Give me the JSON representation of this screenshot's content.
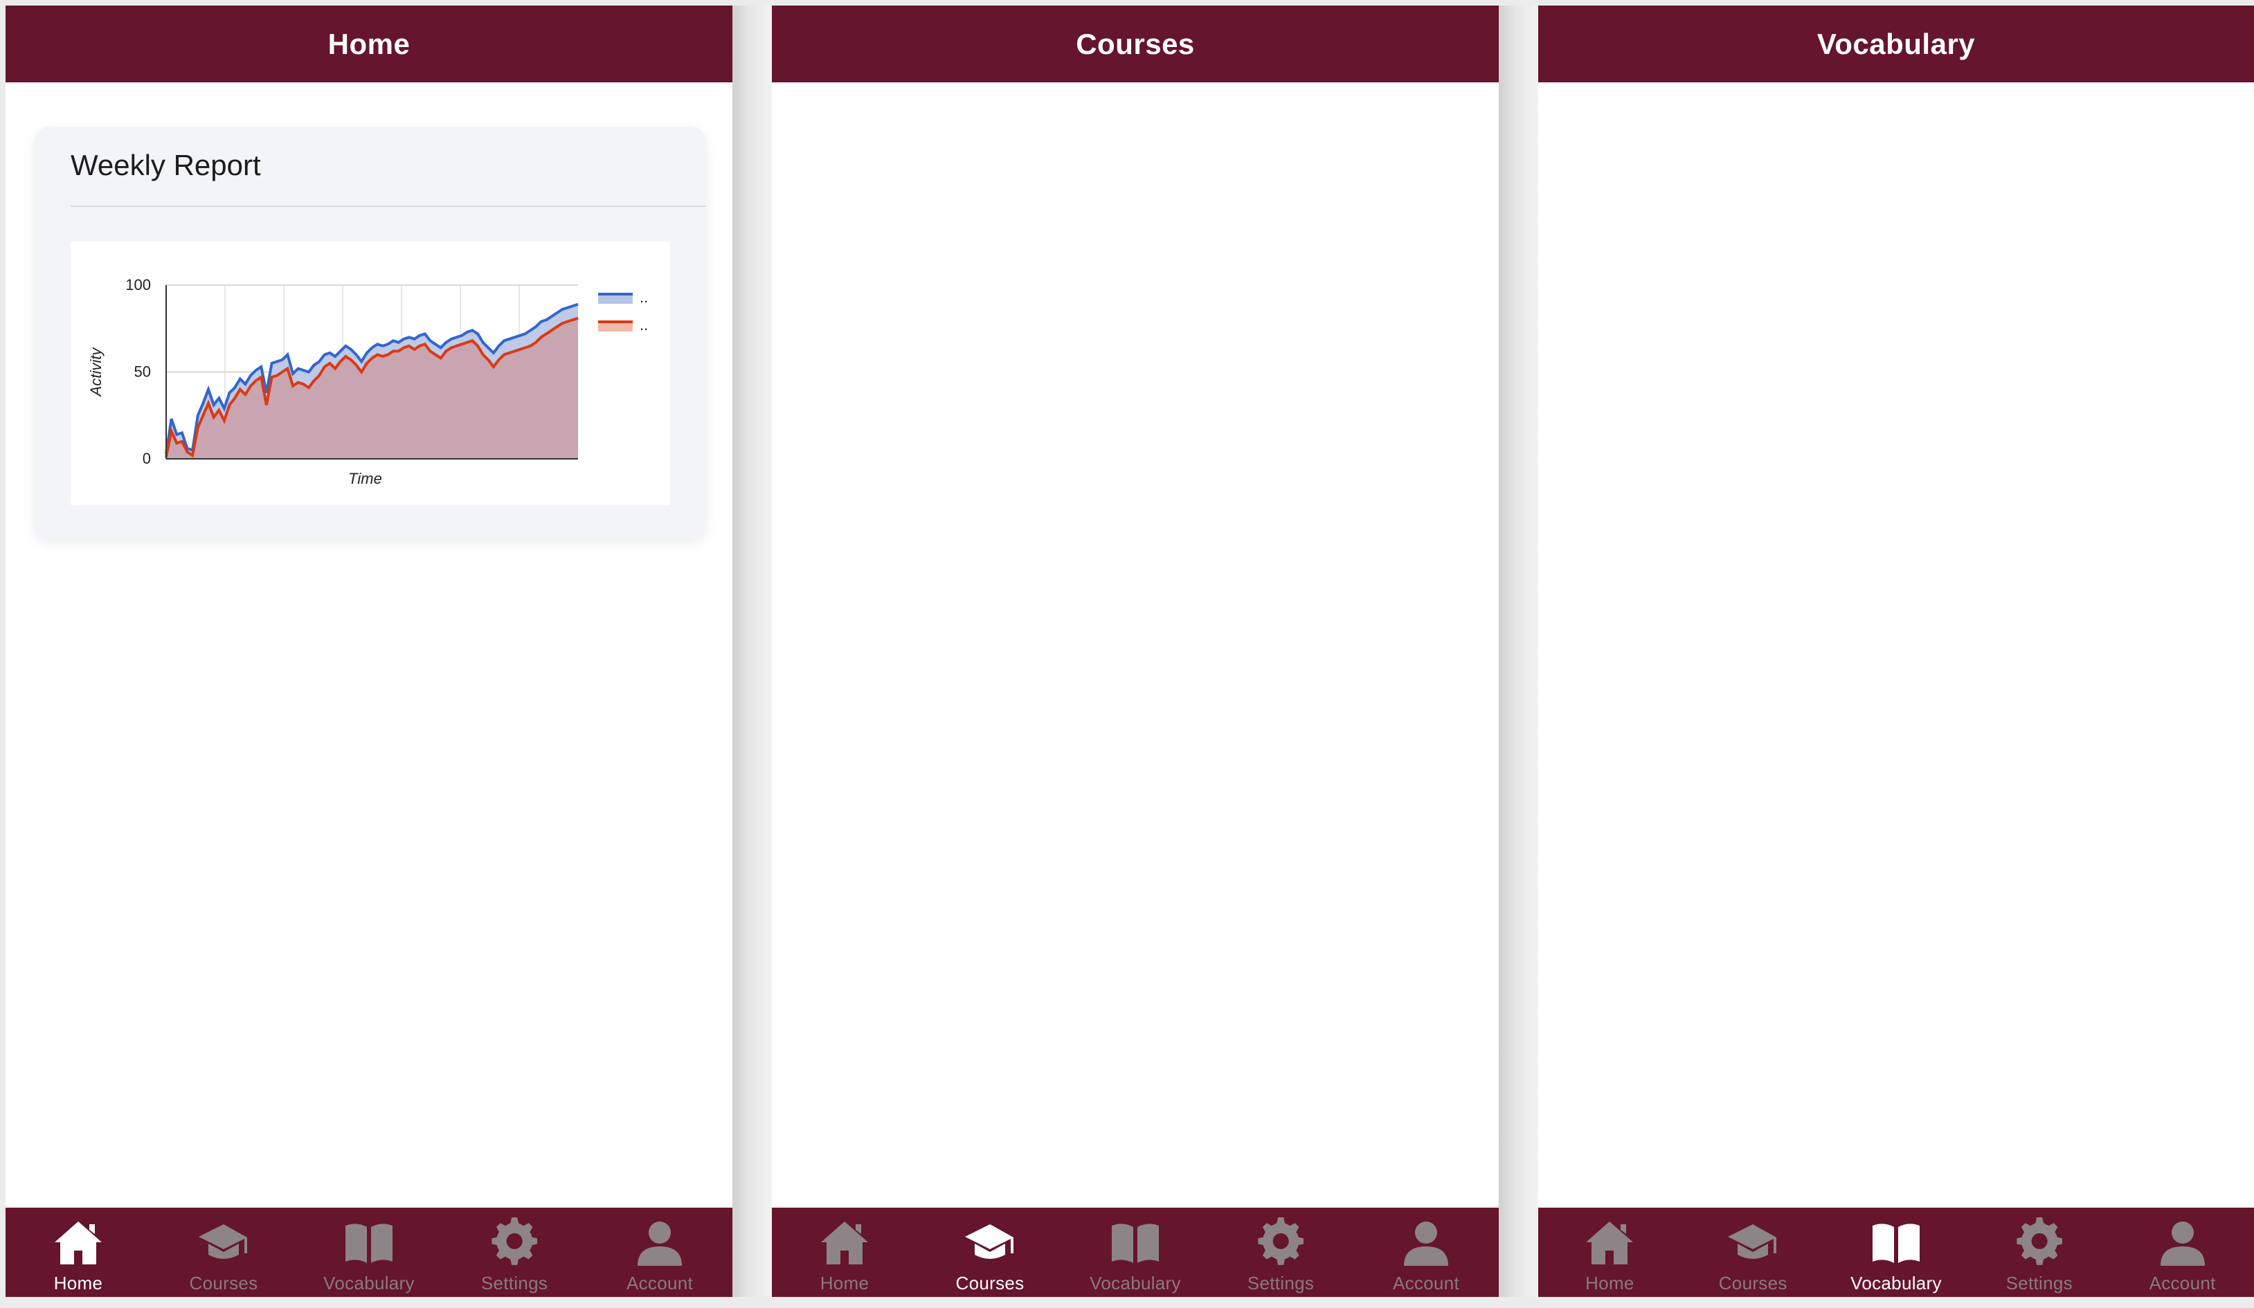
{
  "colors": {
    "brand": "#65152c",
    "tab_inactive": "#8d8487",
    "tab_active": "#ffffff",
    "series_blue": "#3366cc",
    "series_red": "#dc3912",
    "area_fill": "#c9a5b1"
  },
  "screens": [
    {
      "title": "Home",
      "active_tab": 0
    },
    {
      "title": "Courses",
      "active_tab": 1
    },
    {
      "title": "Vocabulary",
      "active_tab": 2
    }
  ],
  "tabs": [
    {
      "label": "Home",
      "icon": "house-icon"
    },
    {
      "label": "Courses",
      "icon": "graduation-cap-icon"
    },
    {
      "label": "Vocabulary",
      "icon": "open-book-icon"
    },
    {
      "label": "Settings",
      "icon": "gear-icon"
    },
    {
      "label": "Account",
      "icon": "user-icon"
    }
  ],
  "weekly_report": {
    "title": "Weekly Report"
  },
  "chart_data": {
    "type": "area",
    "title": "",
    "xlabel": "Time",
    "ylabel": "Activity",
    "ylim": [
      0,
      100
    ],
    "yticks": [
      "0",
      "50",
      "100"
    ],
    "grid": true,
    "legend_placement": "top-right",
    "x": [
      1,
      2,
      3,
      4,
      5,
      6,
      7,
      8,
      9,
      10,
      11,
      12,
      13,
      14,
      15,
      16,
      17,
      18,
      19,
      20,
      21,
      22,
      23,
      24,
      25,
      26,
      27,
      28,
      29,
      30,
      31,
      32,
      33,
      34,
      35,
      36,
      37,
      38,
      39,
      40,
      41,
      42,
      43,
      44,
      45,
      46,
      47,
      48,
      49,
      50,
      51,
      52,
      53,
      54,
      55,
      56,
      57,
      58,
      59,
      60,
      61,
      62,
      63,
      64,
      65,
      66,
      67,
      68,
      69,
      70,
      71,
      72,
      73,
      74,
      75,
      76,
      77,
      78,
      79
    ],
    "series": [
      {
        "name": "..",
        "color": "#3366cc",
        "values": [
          3,
          23,
          14,
          15,
          6,
          5,
          25,
          32,
          40,
          31,
          35,
          29,
          38,
          41,
          46,
          43,
          48,
          51,
          53,
          38,
          55,
          56,
          57,
          60,
          49,
          52,
          51,
          50,
          54,
          56,
          60,
          61,
          59,
          62,
          65,
          63,
          60,
          56,
          61,
          64,
          66,
          65,
          66,
          68,
          67,
          69,
          70,
          69,
          71,
          72,
          68,
          66,
          64,
          67,
          69,
          70,
          71,
          73,
          74,
          72,
          67,
          64,
          61,
          65,
          68,
          69,
          70,
          71,
          72,
          74,
          76,
          79,
          80,
          82,
          84,
          86,
          87,
          88,
          89
        ],
        "values_end": [
          89
        ]
      },
      {
        "name": "..",
        "color": "#dc3912",
        "values": [
          1,
          16,
          9,
          10,
          4,
          2,
          18,
          25,
          32,
          24,
          28,
          22,
          31,
          35,
          40,
          37,
          42,
          45,
          47,
          31,
          47,
          48,
          50,
          52,
          42,
          44,
          43,
          41,
          45,
          48,
          53,
          55,
          52,
          56,
          59,
          57,
          54,
          50,
          55,
          58,
          60,
          59,
          60,
          62,
          62,
          64,
          65,
          63,
          65,
          66,
          62,
          60,
          58,
          62,
          64,
          65,
          66,
          67,
          68,
          65,
          60,
          57,
          53,
          57,
          60,
          61,
          62,
          63,
          64,
          65,
          67,
          70,
          72,
          74,
          76,
          78,
          79,
          80,
          81
        ]
      }
    ]
  }
}
